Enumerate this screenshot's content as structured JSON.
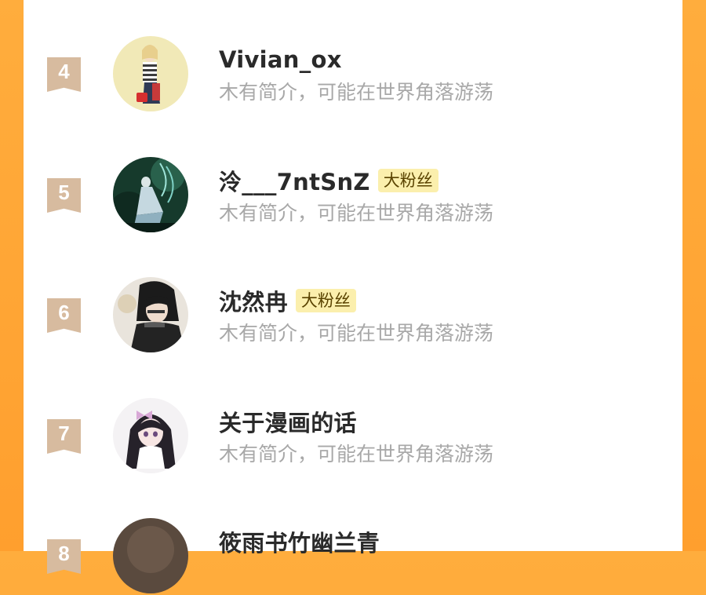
{
  "fan_list": [
    {
      "rank": "4",
      "name": "Vivian_ox",
      "badge": "",
      "bio": "木有简介，可能在世界角落游荡",
      "avatar_icon": "avatar-girl-striped-shirt"
    },
    {
      "rank": "5",
      "name": "泠___7ntSnZ",
      "badge": "大粉丝",
      "bio": "木有简介，可能在世界角落游荡",
      "avatar_icon": "avatar-dark-forest-figure"
    },
    {
      "rank": "6",
      "name": "沈然冉",
      "badge": "大粉丝",
      "bio": "木有简介，可能在世界角落游荡",
      "avatar_icon": "avatar-dark-haired-man"
    },
    {
      "rank": "7",
      "name": "关于漫画的话",
      "badge": "",
      "bio": "木有简介，可能在世界角落游荡",
      "avatar_icon": "avatar-anime-girl-bow"
    },
    {
      "rank": "8",
      "name": "筱雨书竹幽兰青",
      "badge": "",
      "bio": "",
      "avatar_icon": "avatar-brown-circle"
    }
  ],
  "colors": {
    "background_orange": "#ffa534",
    "rank_flag": "#d7bb9f",
    "badge_bg": "#fbefad",
    "name_text": "#2a2a2a",
    "bio_text": "#a8a8a8"
  }
}
